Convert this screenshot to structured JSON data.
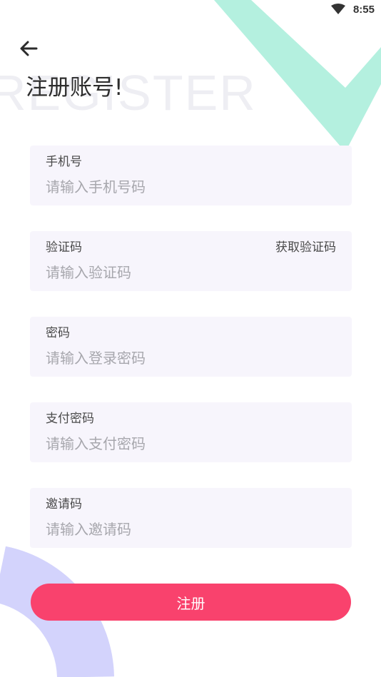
{
  "status_bar": {
    "time": "8:55",
    "wifi_icon": "wifi-icon"
  },
  "header": {
    "back_icon": "arrow-left-icon",
    "watermark": "REGISTER",
    "title": "注册账号!"
  },
  "form": {
    "phone": {
      "label": "手机号",
      "placeholder": "请输入手机号码",
      "value": ""
    },
    "code": {
      "label": "验证码",
      "placeholder": "请输入验证码",
      "value": "",
      "get_code_label": "获取验证码"
    },
    "password": {
      "label": "密码",
      "placeholder": "请输入登录密码",
      "value": ""
    },
    "pay_password": {
      "label": "支付密码",
      "placeholder": "请输入支付密码",
      "value": ""
    },
    "invite": {
      "label": "邀请码",
      "placeholder": "请输入邀请码",
      "value": ""
    }
  },
  "submit_label": "注册",
  "colors": {
    "accent": "#f9426d",
    "field_bg": "#f7f5fc",
    "deco_mint": "#b4f0df",
    "deco_lavender": "#d3d3fc"
  }
}
